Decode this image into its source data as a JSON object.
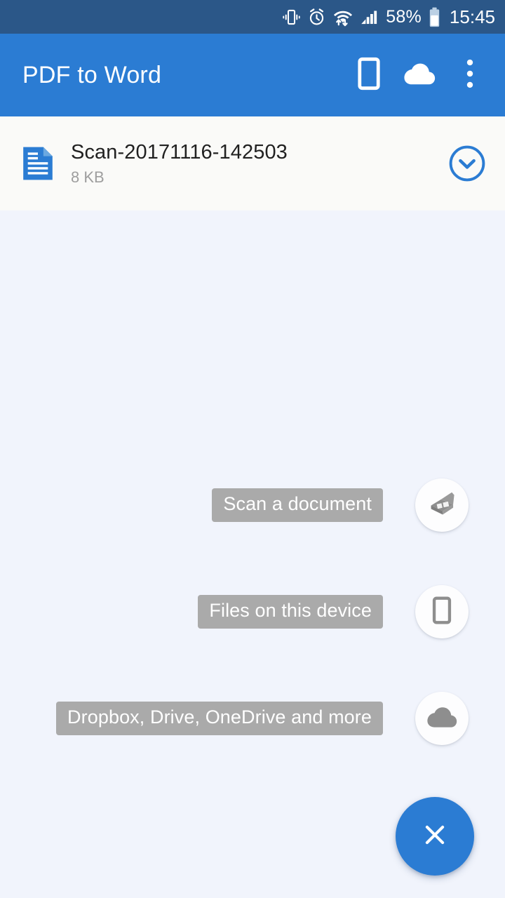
{
  "status_bar": {
    "background_color": "#2B5788",
    "battery_percent": "58%",
    "clock": "15:45",
    "icons": [
      {
        "name": "vibrate-icon",
        "label": "Vibrate mode"
      },
      {
        "name": "alarm-icon",
        "label": "Alarm set"
      },
      {
        "name": "wifi-icon",
        "label": "Wi-Fi connected with data transfer"
      },
      {
        "name": "signal-icon",
        "label": "Mobile signal 4 bars"
      },
      {
        "name": "battery-icon",
        "label": "Battery"
      }
    ]
  },
  "app_bar": {
    "title": "PDF to Word",
    "background_color": "#2B7CD3",
    "text_color": "#FFFFFF",
    "actions": [
      {
        "name": "device-files-action",
        "icon": "phone-icon"
      },
      {
        "name": "cloud-action",
        "icon": "cloud-icon"
      },
      {
        "name": "overflow-action",
        "icon": "more-vert-icon"
      }
    ]
  },
  "file_list": {
    "background_color": "#FAFAF8",
    "items": [
      {
        "icon": "document-icon",
        "name": "Scan-20171116-142503",
        "size": "8 KB",
        "expand_icon": "chevron-down-circle-icon"
      }
    ]
  },
  "speed_dial": {
    "open": true,
    "label_background": "#AAAAAA",
    "label_text_color": "#FFFFFF",
    "fab_color": "#2B7CD3",
    "fab_icon": "close-icon",
    "actions": [
      {
        "label": "Scan a document",
        "icon": "scanner-icon"
      },
      {
        "label": "Files on this device",
        "icon": "phone-icon"
      },
      {
        "label": "Dropbox, Drive, OneDrive and more",
        "icon": "cloud-icon"
      }
    ]
  },
  "page": {
    "background_color": "#F1F4FC"
  }
}
